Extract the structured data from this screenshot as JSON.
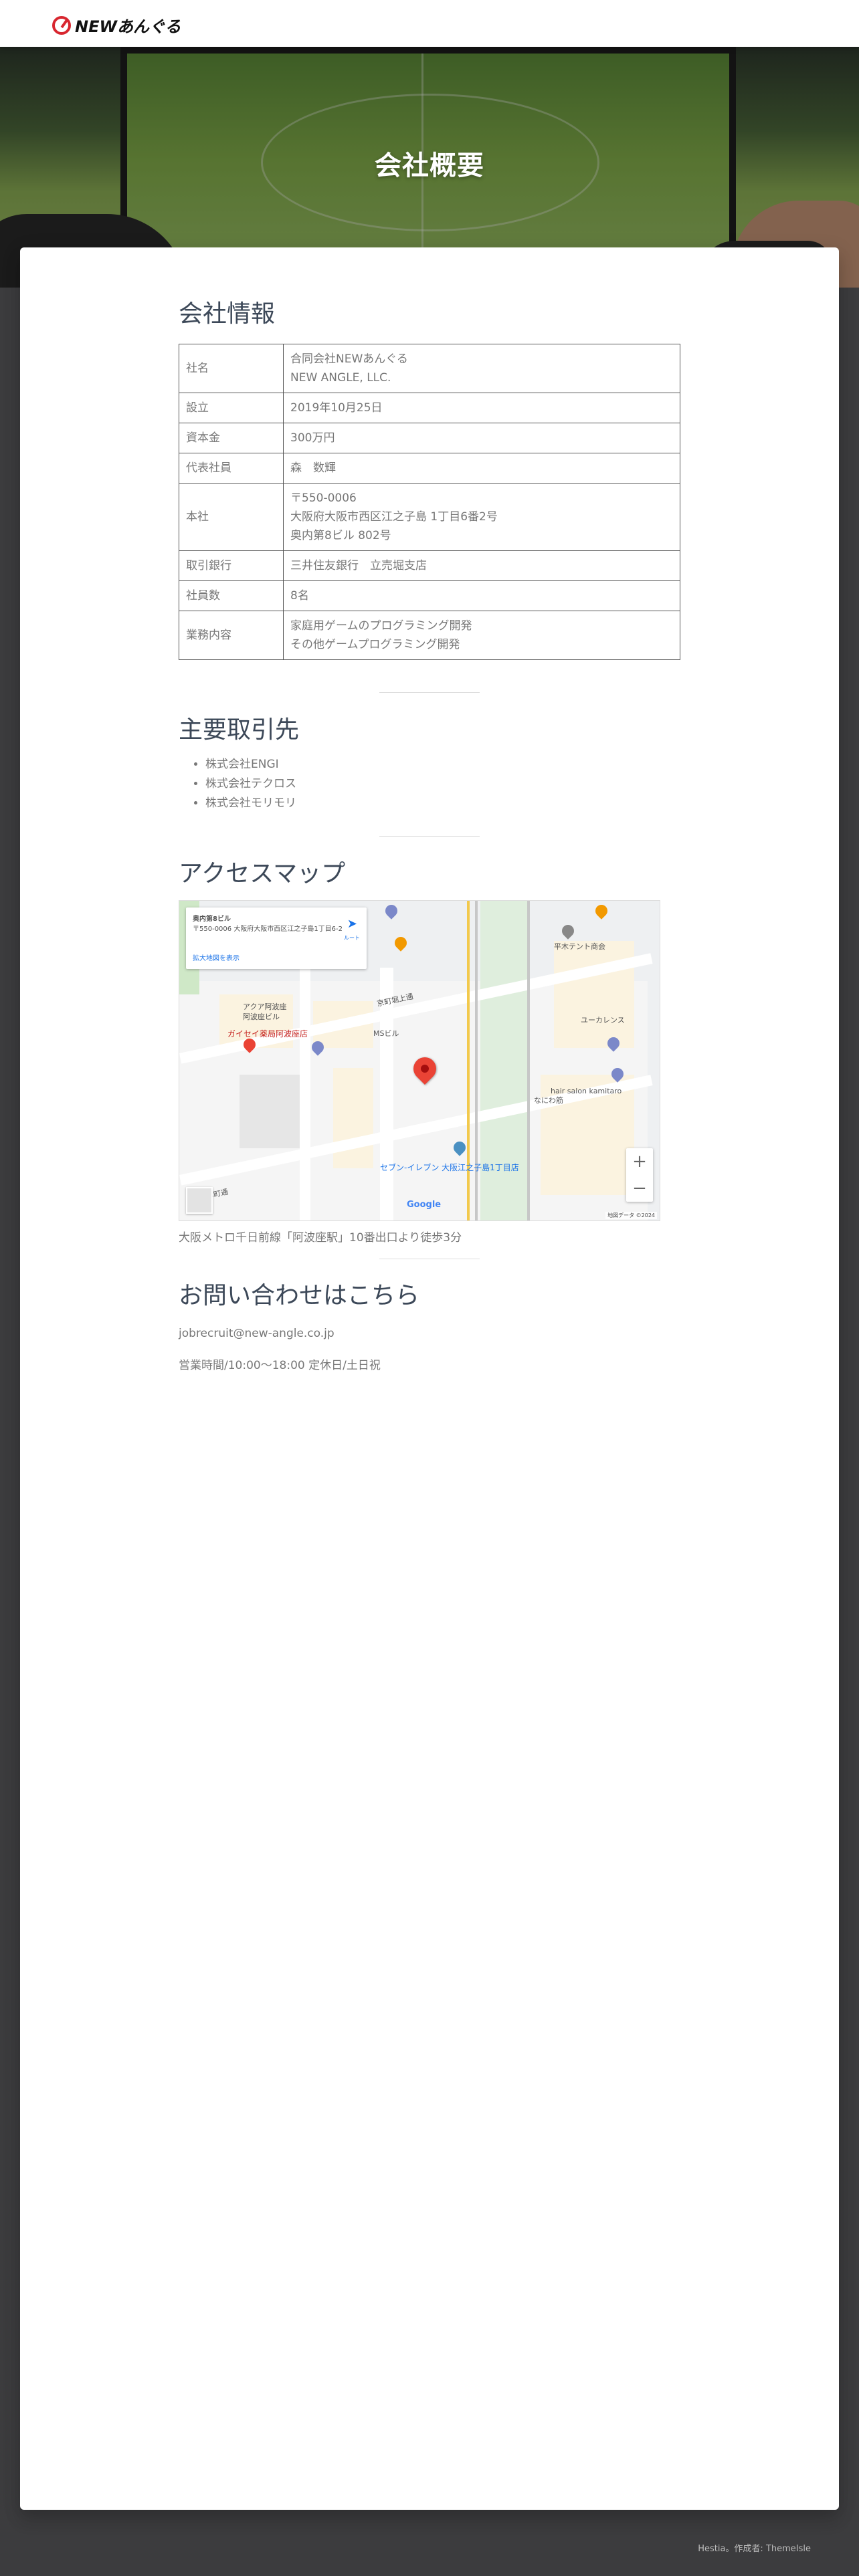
{
  "nav": {
    "logo_text": "NEWあんぐる"
  },
  "hero": {
    "title": "会社概要"
  },
  "company": {
    "heading": "会社情報",
    "rows": [
      {
        "label": "社名",
        "lines": [
          "合同会社NEWあんぐる",
          "NEW ANGLE, LLC."
        ]
      },
      {
        "label": "設立",
        "lines": [
          "2019年10月25日"
        ]
      },
      {
        "label": "資本金",
        "lines": [
          "300万円"
        ]
      },
      {
        "label": "代表社員",
        "lines": [
          "森　数輝"
        ]
      },
      {
        "label": "本社",
        "lines": [
          "〒550-0006",
          "大阪府大阪市西区江之子島 1丁目6番2号",
          "奥内第8ビル 802号"
        ]
      },
      {
        "label": "取引銀行",
        "lines": [
          "三井住友銀行　立売堀支店"
        ]
      },
      {
        "label": "社員数",
        "lines": [
          "8名"
        ]
      },
      {
        "label": "業務内容",
        "lines": [
          "家庭用ゲームのプログラミング開発",
          "その他ゲームプログラミング開発"
        ]
      }
    ]
  },
  "clients": {
    "heading": "主要取引先",
    "items": [
      "株式会社ENGI",
      "株式会社テクロス",
      "株式会社モリモリ"
    ]
  },
  "access": {
    "heading": "アクセスマップ",
    "map": {
      "card_title": "奥内第8ビル",
      "card_address": "〒550-0006 大阪府大阪市西区江之子島1丁目6-2",
      "card_link": "拡大地図を表示",
      "directions_label": "ルート",
      "labels": [
        "京町堀上通",
        "なにわ筋",
        "アクア阿波座",
        "阿波座ビル",
        "ガイセイ薬局阿波座店",
        "セブン-イレブン 大阪江之子島1丁目店",
        "hair salon kamitaro",
        "平木テント商会",
        "ユーカレンス",
        "本町通",
        "MSビル"
      ],
      "zoom_in": "+",
      "zoom_out": "−",
      "google": "Google",
      "footer": "地図データ ©2024"
    },
    "note": "大阪メトロ千日前線「阿波座駅」10番出口より徒歩3分"
  },
  "contact": {
    "heading": "お問い合わせはこちら",
    "email": "jobrecruit@new-angle.co.jp",
    "hours": "営業時間/10:00〜18:00 定休日/土日祝"
  },
  "footer": {
    "prefix": "Hestia。作成者:",
    "author": "ThemeIsle"
  },
  "colors": {
    "brand_red": "#d8262f",
    "map_pin": "#ea4335",
    "text": "#3c4858"
  }
}
